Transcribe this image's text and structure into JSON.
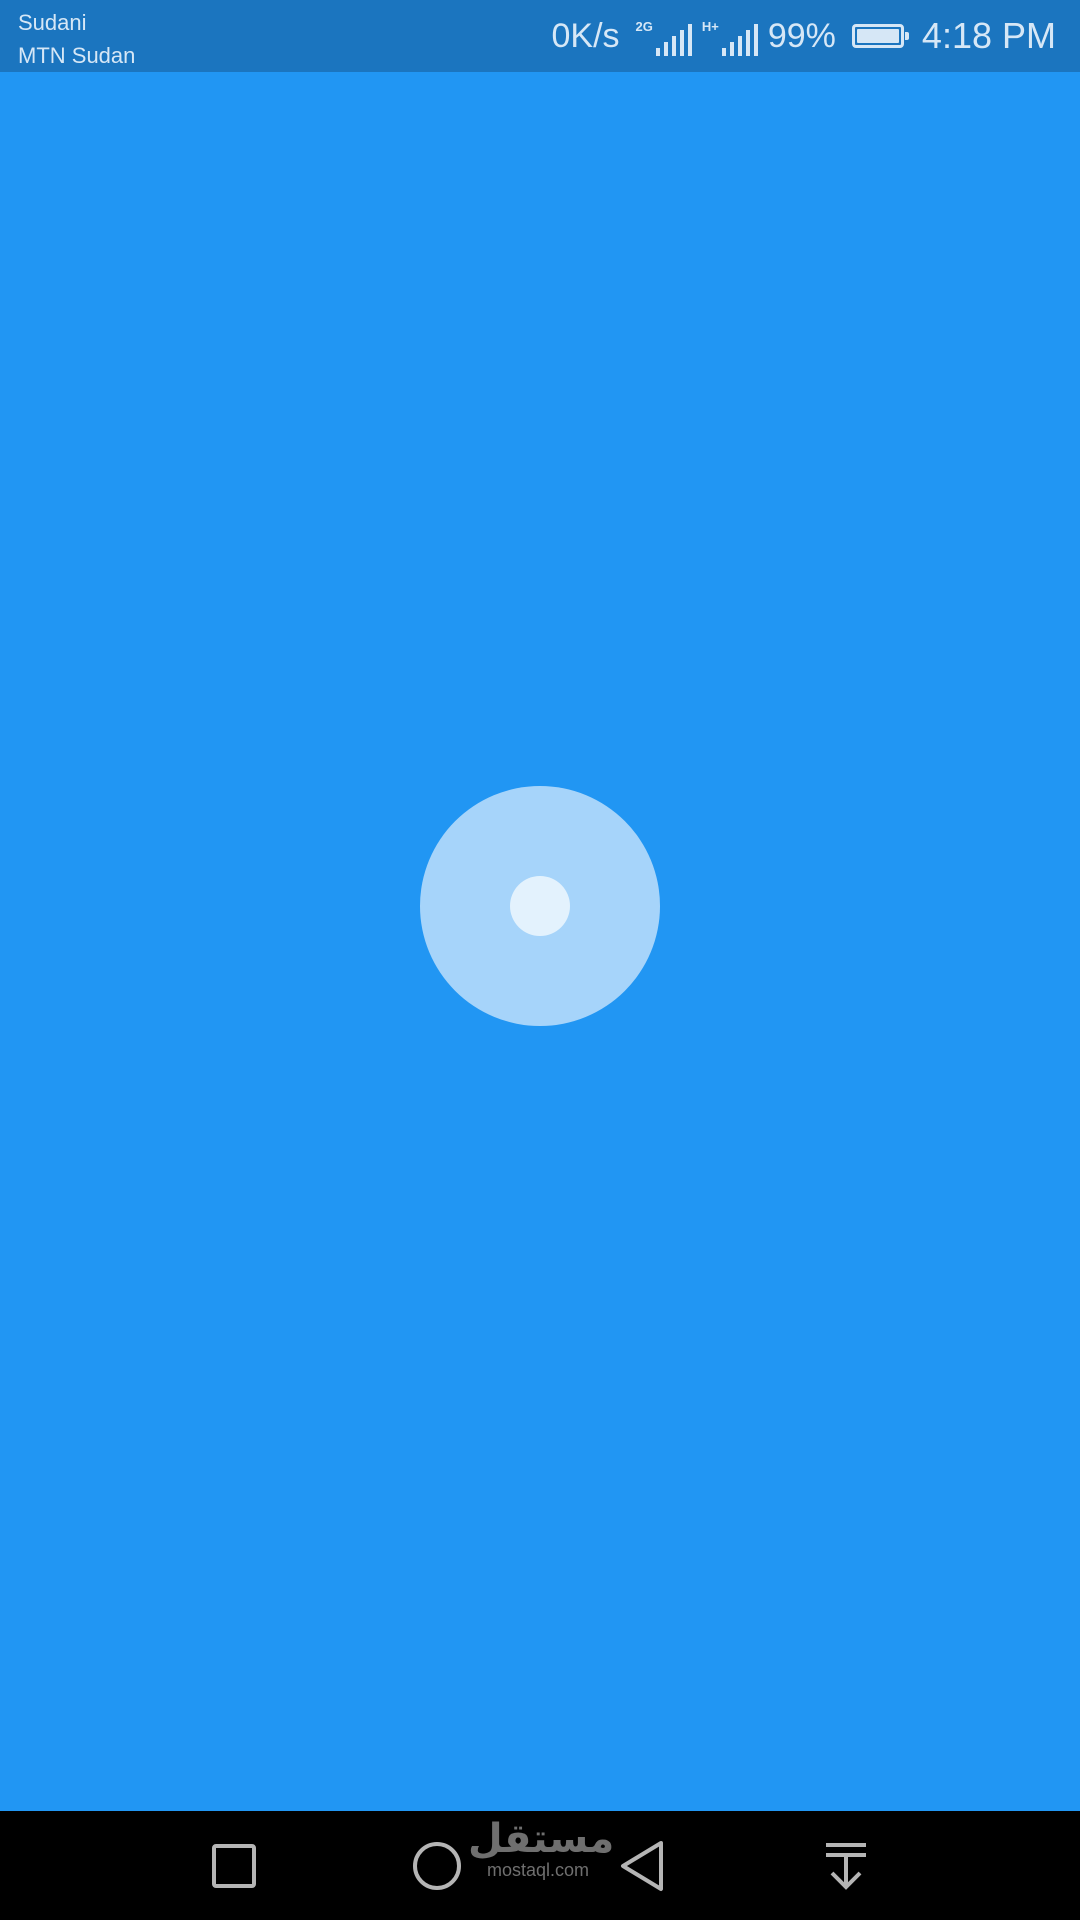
{
  "status_bar": {
    "carrier_1": "Sudani",
    "carrier_2": "MTN Sudan",
    "network_speed": "0K/s",
    "sim1_network": "2G",
    "sim2_network": "H+",
    "battery_percent": "99%",
    "battery_level": 0.99,
    "time": "4:18 PM"
  },
  "main": {
    "indicator_icon": "loading-dot-icon"
  },
  "nav_bar": {
    "recent_apps_icon": "square-icon",
    "home_icon": "circle-icon",
    "back_icon": "triangle-back-icon",
    "notifications_icon": "pull-down-icon"
  },
  "watermark": {
    "arabic": "مستقل",
    "latin": "mostaql.com"
  },
  "colors": {
    "background": "#2196F3",
    "status_bar": "#1B75BF",
    "indicator_outer": "#A6D4FA",
    "indicator_inner": "#E3F2FD",
    "nav_bar": "#000000"
  }
}
